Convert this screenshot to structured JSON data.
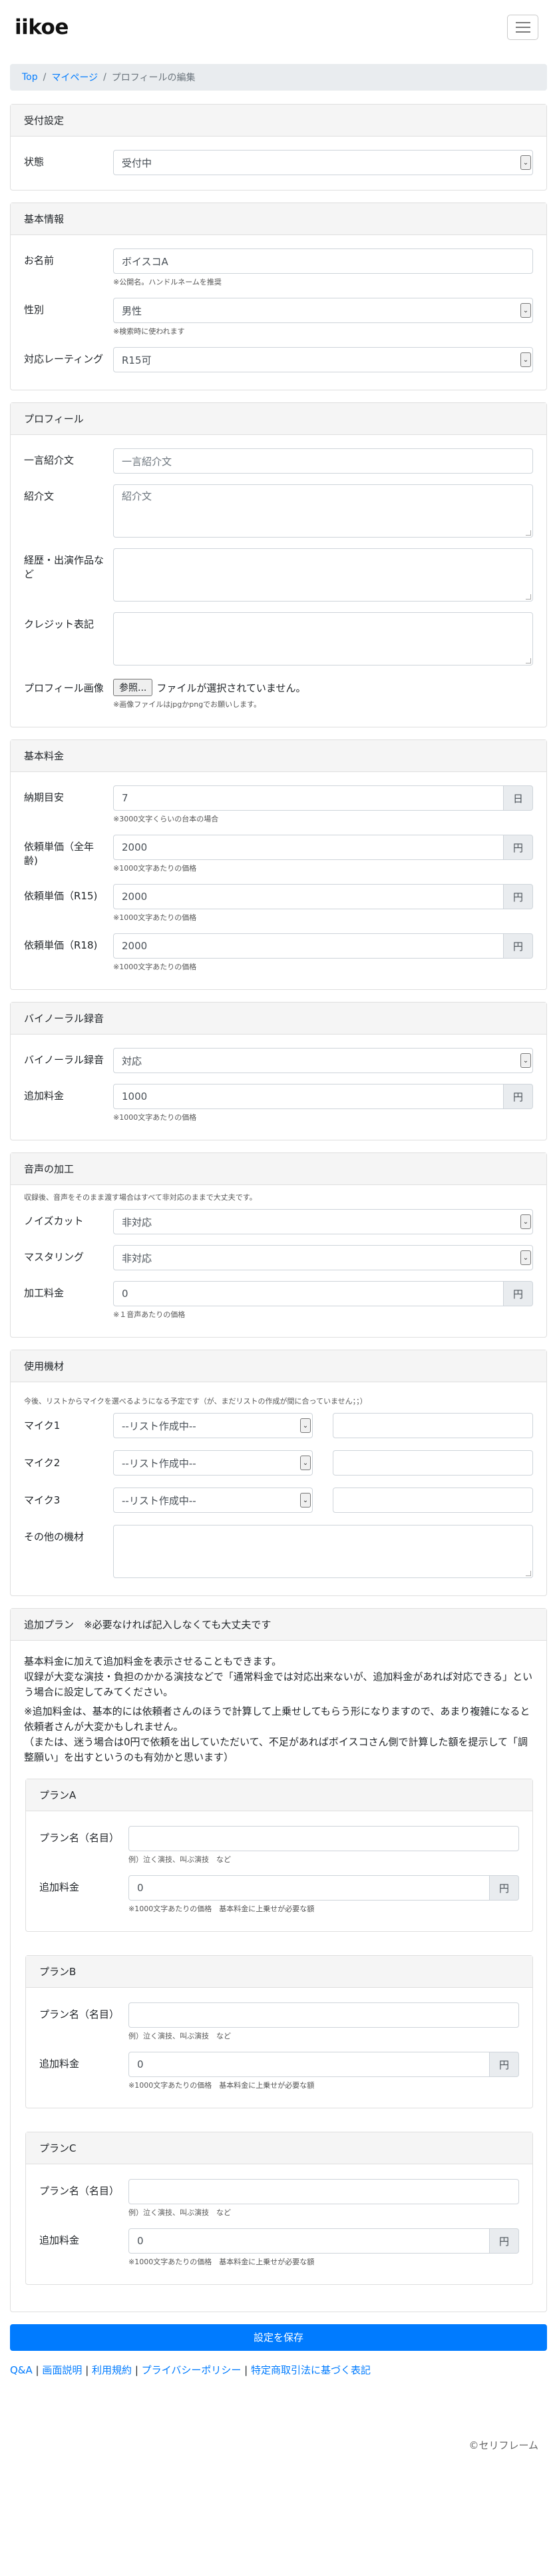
{
  "brand": "iikoe",
  "breadcrumb": {
    "home": "Top",
    "mypage": "マイページ",
    "current": "プロフィールの編集"
  },
  "reception": {
    "header": "受付設定",
    "status_label": "状態",
    "status_value": "受付中"
  },
  "basic": {
    "header": "基本情報",
    "name_label": "お名前",
    "name_value": "ボイスコA",
    "name_hint": "※公開名。ハンドルネームを推奨",
    "gender_label": "性別",
    "gender_value": "男性",
    "gender_hint": "※検索時に使われます",
    "rating_label": "対応レーティング",
    "rating_value": "R15可"
  },
  "profile": {
    "header": "プロフィール",
    "catch_label": "一言紹介文",
    "catch_placeholder": "一言紹介文",
    "intro_label": "紹介文",
    "intro_placeholder": "紹介文",
    "career_label": "経歴・出演作品など",
    "credit_label": "クレジット表記",
    "image_label": "プロフィール画像",
    "file_button": "参照...",
    "file_status": "ファイルが選択されていません。",
    "image_hint": "※画像ファイルはjpgかpngでお願いします。"
  },
  "pricing": {
    "header": "基本料金",
    "delivery_label": "納期目安",
    "delivery_value": "7",
    "delivery_unit": "日",
    "delivery_hint": "※3000文字くらいの台本の場合",
    "all_label": "依頼単価（全年齢)",
    "all_value": "2000",
    "r15_label": "依頼単価（R15)",
    "r15_value": "2000",
    "r18_label": "依頼単価（R18)",
    "r18_value": "2000",
    "yen": "円",
    "per_1000": "※1000文字あたりの価格"
  },
  "binaural": {
    "header": "バイノーラル録音",
    "label": "バイノーラル録音",
    "value": "対応",
    "fee_label": "追加料金",
    "fee_value": "1000",
    "yen": "円",
    "fee_hint": "※1000文字あたりの価格"
  },
  "audio": {
    "header": "音声の加工",
    "note": "収録後、音声をそのまま渡す場合はすべて非対応のままで大丈夫です。",
    "noise_label": "ノイズカット",
    "noise_value": "非対応",
    "master_label": "マスタリング",
    "master_value": "非対応",
    "fee_label": "加工料金",
    "fee_value": "0",
    "yen": "円",
    "fee_hint": "※１音声あたりの価格"
  },
  "equipment": {
    "header": "使用機材",
    "note": "今後、リストからマイクを選べるようになる予定です（が、まだリストの作成が間に合っていません；；）",
    "mic1_label": "マイク1",
    "mic2_label": "マイク2",
    "mic3_label": "マイク3",
    "mic_select": "--リスト作成中--",
    "other_label": "その他の機材"
  },
  "plans": {
    "header": "追加プラン　※必要なければ記入しなくても大丈夫です",
    "intro1": "基本料金に加えて追加料金を表示させることもできます。",
    "intro2": "収録が大変な演技・負担のかかる演技などで「通常料金では対応出来ないが、追加料金があれば対応できる」という場合に設定してみてください。",
    "note1": "※追加料金は、基本的には依頼者さんのほうで計算して上乗せしてもらう形になりますので、あまり複雑になると依頼者さんが大変かもしれません。",
    "note2": "（または、迷う場合は0円で依頼を出していただいて、不足があればボイスコさん側で計算した額を提示して「調整願い」を出すというのも有効かと思います）",
    "name_label": "プラン名（名目）",
    "name_hint": "例）泣く演技、叫ぶ演技　など",
    "fee_label": "追加料金",
    "fee_value": "0",
    "yen": "円",
    "fee_hint": "※1000文字あたりの価格　基本料金に上乗せが必要な額",
    "items": [
      {
        "title": "プランA"
      },
      {
        "title": "プランB"
      },
      {
        "title": "プランC"
      }
    ]
  },
  "save_button": "設定を保存",
  "footer": {
    "qa": "Q&A",
    "screens": "画面説明",
    "terms": "利用規約",
    "privacy": "プライバシーポリシー",
    "commerce": "特定商取引法に基づく表記",
    "sep": "|",
    "copyright": "©セリフレーム"
  }
}
